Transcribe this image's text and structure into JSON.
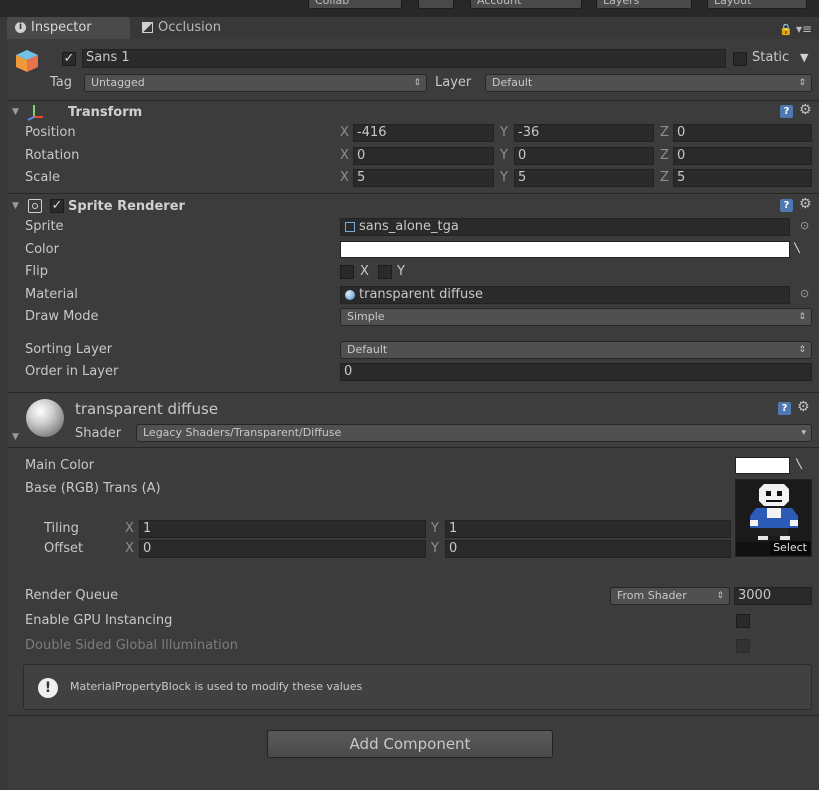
{
  "toolbar": {
    "collab": "Collab",
    "account": "Account",
    "layers": "Layers",
    "layout": "Layout"
  },
  "tabs": {
    "inspector": "Inspector",
    "occlusion": "Occlusion"
  },
  "gameobject": {
    "name": "Sans 1",
    "static_label": "Static",
    "tag_label": "Tag",
    "tag_value": "Untagged",
    "layer_label": "Layer",
    "layer_value": "Default"
  },
  "transform": {
    "title": "Transform",
    "position": {
      "label": "Position",
      "x": "-416",
      "y": "-36",
      "z": "0"
    },
    "rotation": {
      "label": "Rotation",
      "x": "0",
      "y": "0",
      "z": "0"
    },
    "scale": {
      "label": "Scale",
      "x": "5",
      "y": "5",
      "z": "5"
    }
  },
  "axis": {
    "x": "X",
    "y": "Y",
    "z": "Z"
  },
  "sprite_renderer": {
    "title": "Sprite Renderer",
    "sprite_label": "Sprite",
    "sprite_value": "sans_alone_tga",
    "color_label": "Color",
    "color_value": "#ffffff",
    "flip_label": "Flip",
    "flip_x": "X",
    "flip_y": "Y",
    "material_label": "Material",
    "material_value": "transparent diffuse",
    "draw_mode_label": "Draw Mode",
    "draw_mode_value": "Simple",
    "sorting_layer_label": "Sorting Layer",
    "sorting_layer_value": "Default",
    "order_label": "Order in Layer",
    "order_value": "0"
  },
  "material": {
    "name": "transparent diffuse",
    "shader_label": "Shader",
    "shader_value": "Legacy Shaders/Transparent/Diffuse",
    "main_color_label": "Main Color",
    "base_label": "Base (RGB) Trans (A)",
    "tiling_label": "Tiling",
    "tiling_x": "1",
    "tiling_y": "1",
    "offset_label": "Offset",
    "offset_x": "0",
    "offset_y": "0",
    "select_label": "Select",
    "render_queue_label": "Render Queue",
    "render_queue_mode": "From Shader",
    "render_queue_value": "3000",
    "gpu_instancing_label": "Enable GPU Instancing",
    "double_sided_label": "Double Sided Global Illumination",
    "info_message": "MaterialPropertyBlock is used to modify these values"
  },
  "add_component": "Add Component"
}
